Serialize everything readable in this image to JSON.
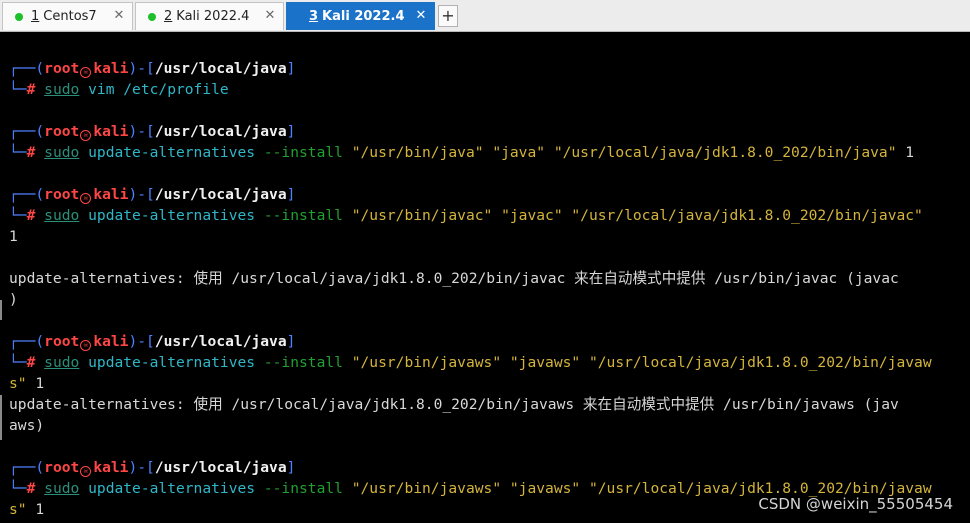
{
  "tabs": [
    {
      "num": "1",
      "title": "Centos7",
      "close": "✕"
    },
    {
      "num": "2",
      "title": "Kali 2022.4",
      "close": "✕"
    },
    {
      "num": "3",
      "title": "Kali 2022.4",
      "close": "✕",
      "active": true
    }
  ],
  "add_tab": "+",
  "prompt": {
    "corner_top": "┌──(",
    "user": "root",
    "skull": "☠",
    "host": "kali",
    "mid": ")-[",
    "cwd": "/usr/local/java",
    "end": "]",
    "corner_bottom": "└─",
    "hash": "#"
  },
  "commands": {
    "c1": {
      "sudo": "sudo",
      "rest": "vim /etc/profile"
    },
    "c2": {
      "sudo": "sudo",
      "cmd": "update-alternatives",
      "flag": "--install",
      "args": "\"/usr/bin/java\" \"java\" \"/usr/local/java/jdk1.8.0_202/bin/java\"",
      "tail": " 1"
    },
    "c3": {
      "sudo": "sudo",
      "cmd": "update-alternatives",
      "flag": "--install",
      "args": "\"/usr/bin/javac\" \"javac\" \"/usr/local/java/jdk1.8.0_202/bin/javac\"",
      "wrap": "1"
    },
    "c4": {
      "sudo": "sudo",
      "cmd": "update-alternatives",
      "flag": "--install",
      "args": "\"/usr/bin/javaws\" \"javaws\" \"/usr/local/java/jdk1.8.0_202/bin/javaw",
      "wrap_args": "s\"",
      "tail": " 1"
    },
    "c5": {
      "sudo": "sudo",
      "cmd": "update-alternatives",
      "flag": "--install",
      "args": "\"/usr/bin/javaws\" \"javaws\" \"/usr/local/java/jdk1.8.0_202/bin/javaw",
      "wrap_args": "s\"",
      "tail": " 1"
    }
  },
  "outputs": {
    "o1_line1": "update-alternatives: 使用 /usr/local/java/jdk1.8.0_202/bin/javac 来在自动模式中提供 /usr/bin/javac (javac",
    "o1_line2": ")",
    "o2_line1": "update-alternatives: 使用 /usr/local/java/jdk1.8.0_202/bin/javaws 来在自动模式中提供 /usr/bin/javaws (jav",
    "o2_line2": "aws)"
  },
  "watermark": "CSDN @weixin_55505454",
  "colors": {
    "tab_active": "#1a73c8",
    "status_dot": "#1dbf2b",
    "prompt_frame": "#4f80ff",
    "prompt_user": "#ff4646",
    "command": "#2fb7c8",
    "option": "#20a030",
    "string": "#d4b43c",
    "background": "#000000"
  }
}
